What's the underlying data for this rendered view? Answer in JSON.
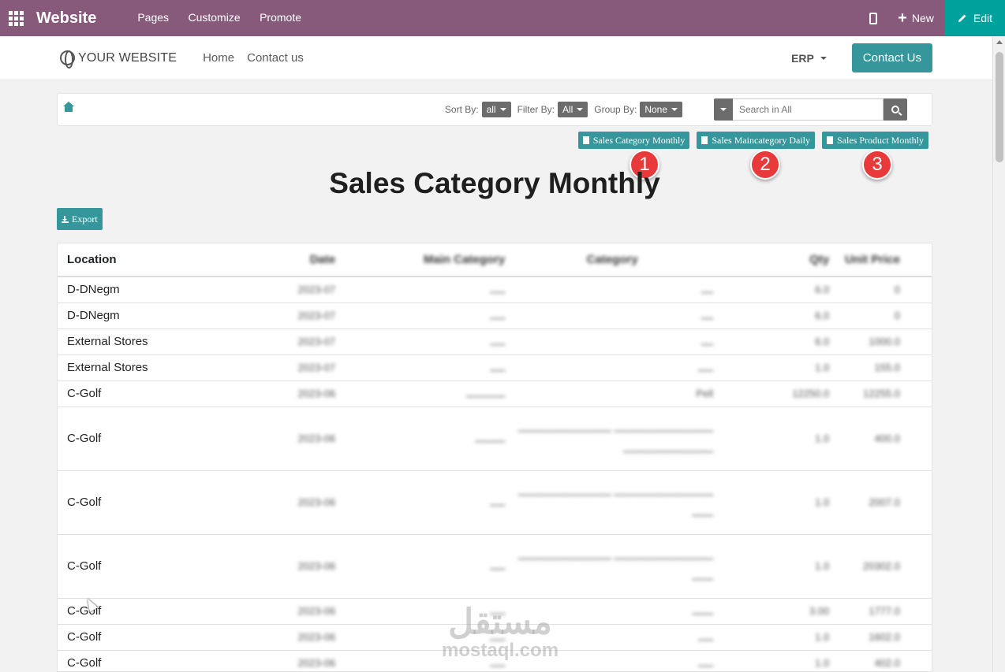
{
  "topbar": {
    "brand": "Website",
    "nav": [
      "Pages",
      "Customize",
      "Promote"
    ],
    "new_label": "New",
    "edit_label": "Edit",
    "bg_color": "#875a7b",
    "edit_color": "#00a09d"
  },
  "header": {
    "logo_text": "YOUR WEBSITE",
    "nav": [
      "Home",
      "Contact us"
    ],
    "erp_label": "ERP",
    "contact_button": "Contact Us"
  },
  "filters": {
    "sort_label": "Sort By:",
    "sort_value": "all",
    "filter_label": "Filter By:",
    "filter_value": "All",
    "group_label": "Group By:",
    "group_value": "None",
    "search_placeholder": "Search in All"
  },
  "reports": [
    {
      "label": "Sales Category Monthly",
      "badge": "1"
    },
    {
      "label": "Sales Maincategory Daily",
      "badge": "2"
    },
    {
      "label": "Sales Product Monthly",
      "badge": "3"
    }
  ],
  "page_title": "Sales Category Monthly",
  "export_label": "Export",
  "table": {
    "headers": [
      "Location",
      "Date",
      "Main Category",
      "Category",
      "Qty",
      "Unit Price"
    ],
    "rows": [
      {
        "location": "D-DNegm",
        "date": "2023-07",
        "main": "ـــــ",
        "cat": "ــــ",
        "qty": "6.0",
        "unit": "0",
        "lines": 1
      },
      {
        "location": "D-DNegm",
        "date": "2023-07",
        "main": "ـــــ",
        "cat": "ــــ",
        "qty": "6.0",
        "unit": "0",
        "lines": 1
      },
      {
        "location": "External Stores",
        "date": "2023-07",
        "main": "ـــــ",
        "cat": "ــــ",
        "qty": "6.0",
        "unit": "1000.0",
        "lines": 1
      },
      {
        "location": "External Stores",
        "date": "2023-07",
        "main": "ـــــ",
        "cat": "ـــــ",
        "qty": "1.0",
        "unit": "155.0",
        "lines": 1
      },
      {
        "location": "C-Golf",
        "date": "2023-06",
        "main": "ـــــــــــــ",
        "cat": "Pell",
        "qty": "12250.0",
        "unit": "12255.0",
        "lines": 1
      },
      {
        "location": "C-Golf",
        "date": "2023-06",
        "main": "ــــــــــ",
        "cat": "ـــــــــــــــــــــــــــــــــ ـــــــــــــــــــــــــــــــ ــــــــــــــــــــــــــــــ",
        "qty": "1.0",
        "unit": "400.0",
        "lines": 3
      },
      {
        "location": "C-Golf",
        "date": "2023-06",
        "main": "ـــــ",
        "cat": "ـــــــــــــــــــــــــــــــــ ـــــــــــــــــــــــــــــــ ـــــــ",
        "qty": "1.0",
        "unit": "2007.0",
        "lines": 3
      },
      {
        "location": "C-Golf",
        "date": "2023-06",
        "main": "ـــــ",
        "cat": "ـــــــــــــــــــــــــــــــــ ـــــــــــــــــــــــــــــــ ـــــــ",
        "qty": "1.0",
        "unit": "20302.0",
        "lines": 3
      },
      {
        "location": "C-Golf",
        "date": "2023-06",
        "main": "ـــــ",
        "cat": "ـــــــ",
        "qty": "3.00",
        "unit": "1777.0",
        "lines": 1
      },
      {
        "location": "C-Golf",
        "date": "2023-06",
        "main": "ـــــ",
        "cat": "ـــــ",
        "qty": "1.0",
        "unit": "1602.0",
        "lines": 1
      },
      {
        "location": "C-Golf",
        "date": "2023-06",
        "main": "ـــــ",
        "cat": "ـــــ",
        "qty": "1.0",
        "unit": "402.0",
        "lines": 1
      }
    ]
  },
  "watermark": {
    "arabic": "مستقل",
    "latin": "mostaql.com"
  }
}
